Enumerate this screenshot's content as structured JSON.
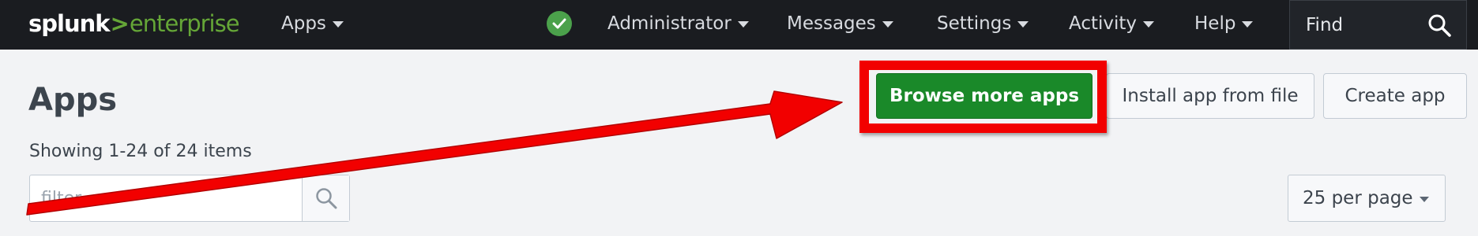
{
  "brand": {
    "name_part1": "splunk",
    "separator": ">",
    "name_part2": "enterprise"
  },
  "nav": {
    "apps": "Apps",
    "administrator": "Administrator",
    "messages": "Messages",
    "settings": "Settings",
    "activity": "Activity",
    "help": "Help",
    "find": "Find",
    "status_icon": "check-circle-icon"
  },
  "page": {
    "title": "Apps",
    "item_count": "Showing 1-24 of 24 items",
    "filter_placeholder": "filter",
    "per_page": "25 per page"
  },
  "actions": {
    "browse": "Browse more apps",
    "install": "Install app from file",
    "create": "Create app"
  },
  "annotation": {
    "color": "#f20000",
    "type": "arrow-and-highlight-box"
  },
  "colors": {
    "topbar": "#1a1c20",
    "brand_green": "#65a637",
    "primary_button": "#1a8929",
    "page_bg": "#f2f3f5"
  }
}
